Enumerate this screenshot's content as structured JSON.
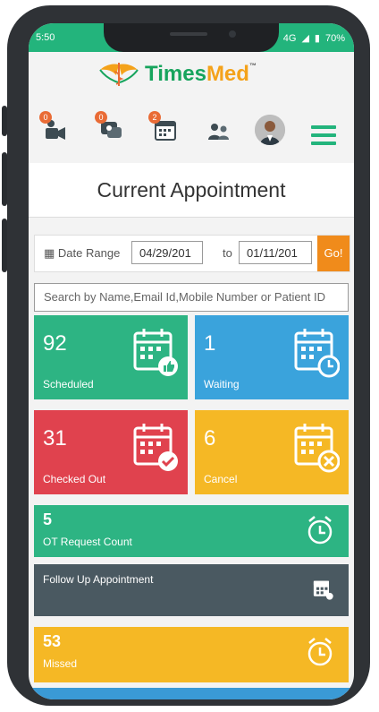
{
  "status": {
    "time": "5:50",
    "network": "4G",
    "battery": "70%"
  },
  "brand": {
    "name_a": "Times",
    "name_b": "Med",
    "tm": "™"
  },
  "toolbar": {
    "badges": {
      "video": "0",
      "chat": "0",
      "calendar": "2"
    }
  },
  "page": {
    "title": "Current Appointment"
  },
  "filter": {
    "date_range_label": "Date Range",
    "from_date": "04/29/201",
    "to_label": "to",
    "to_date": "01/11/201",
    "go_label": "Go!",
    "search_placeholder": "Search by Name,Email Id,Mobile Number or Patient ID"
  },
  "tiles": {
    "scheduled": {
      "count": "92",
      "label": "Scheduled",
      "color": "#2db483"
    },
    "waiting": {
      "count": "1",
      "label": "Waiting",
      "color": "#3aa3dc"
    },
    "checked_out": {
      "count": "31",
      "label": "Checked Out",
      "color": "#e0424e"
    },
    "cancel": {
      "count": "6",
      "label": "Cancel",
      "color": "#f5b825"
    }
  },
  "rows": {
    "ot_request": {
      "count": "5",
      "label": "OT Request Count",
      "color": "#2db483"
    },
    "follow_up": {
      "label": "Follow Up Appointment",
      "color": "#4a5961"
    },
    "missed": {
      "count": "53",
      "label": "Missed",
      "color": "#f5b825"
    }
  },
  "colors": {
    "accent": "#23b47c",
    "go": "#f08b1b"
  }
}
